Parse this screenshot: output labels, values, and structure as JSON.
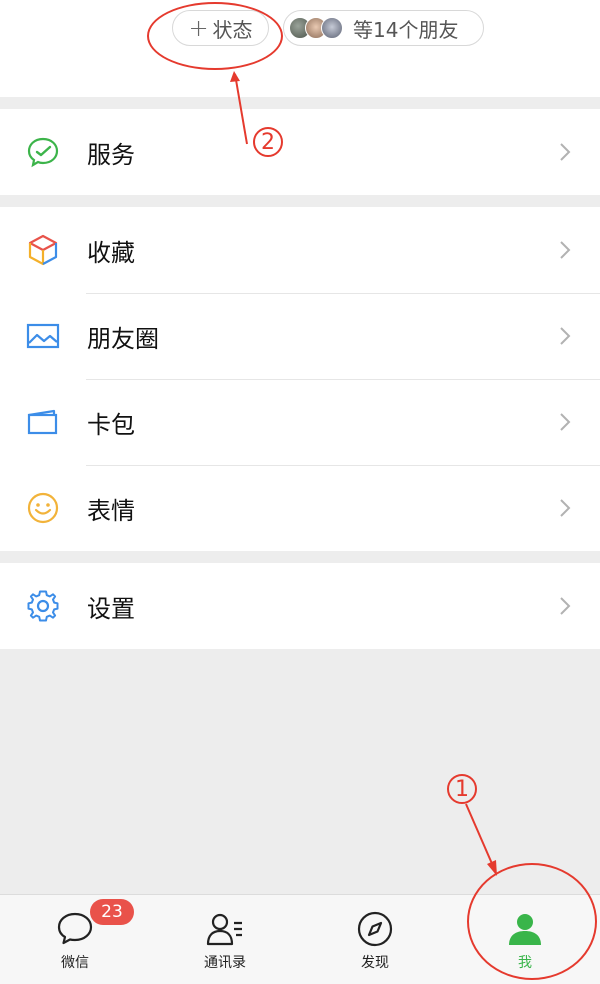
{
  "status": {
    "plus": "+",
    "label": "状态",
    "friends_text": "等14个朋友"
  },
  "menu": {
    "service": "服务",
    "favorites": "收藏",
    "moments": "朋友圈",
    "cards": "卡包",
    "stickers": "表情",
    "settings": "设置"
  },
  "annotations": {
    "one": "1",
    "two": "2"
  },
  "tabbar": {
    "chats": "微信",
    "chats_badge": "23",
    "contacts": "通讯录",
    "discover": "发现",
    "me": "我"
  },
  "colors": {
    "accent_green": "#39b54a",
    "badge_red": "#e9524a",
    "annotation_red": "#e53a2e"
  }
}
